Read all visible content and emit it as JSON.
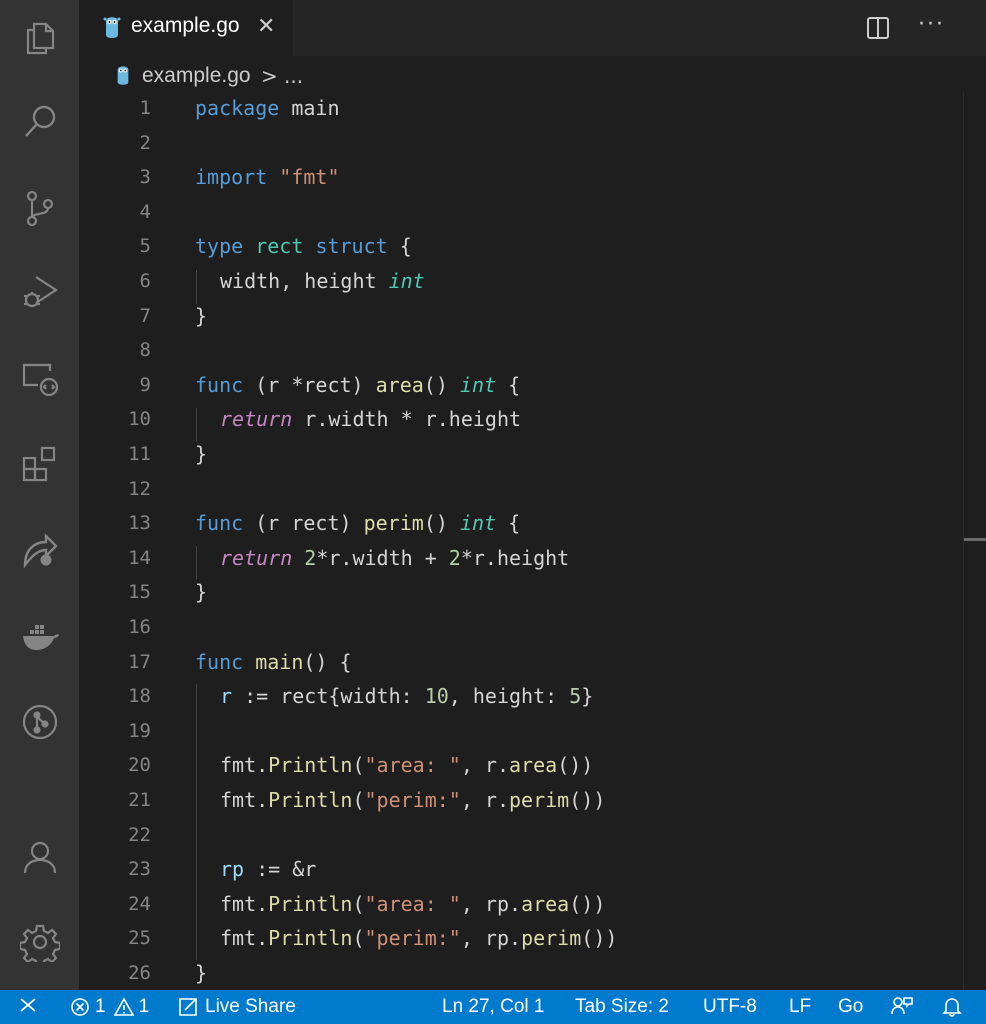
{
  "activity_bar": {
    "items": [
      {
        "name": "explorer-icon"
      },
      {
        "name": "search-icon"
      },
      {
        "name": "source-control-icon"
      },
      {
        "name": "run-debug-icon"
      },
      {
        "name": "remote-explorer-icon"
      },
      {
        "name": "extensions-icon"
      },
      {
        "name": "live-share-icon"
      },
      {
        "name": "docker-icon"
      },
      {
        "name": "gitlens-icon"
      }
    ],
    "bottom": [
      {
        "name": "account-icon"
      },
      {
        "name": "settings-gear-icon"
      }
    ]
  },
  "tab": {
    "label": "example.go",
    "close": "✕"
  },
  "tab_actions": {
    "more": "···"
  },
  "breadcrumb": {
    "file": "example.go",
    "separator": ">",
    "more": "..."
  },
  "code_lines": [
    {
      "n": "1"
    },
    {
      "n": "2"
    },
    {
      "n": "3"
    },
    {
      "n": "4"
    },
    {
      "n": "5"
    },
    {
      "n": "6"
    },
    {
      "n": "7"
    },
    {
      "n": "8"
    },
    {
      "n": "9"
    },
    {
      "n": "10"
    },
    {
      "n": "11"
    },
    {
      "n": "12"
    },
    {
      "n": "13"
    },
    {
      "n": "14"
    },
    {
      "n": "15"
    },
    {
      "n": "16"
    },
    {
      "n": "17"
    },
    {
      "n": "18"
    },
    {
      "n": "19"
    },
    {
      "n": "20"
    },
    {
      "n": "21"
    },
    {
      "n": "22"
    },
    {
      "n": "23"
    },
    {
      "n": "24"
    },
    {
      "n": "25"
    },
    {
      "n": "26"
    }
  ],
  "code": {
    "l1": {
      "a": "package",
      "b": " main"
    },
    "l3": {
      "a": "import",
      "b": " ",
      "c": "\"fmt\""
    },
    "l5": {
      "a": "type",
      "b": " ",
      "c": "rect",
      "d": " ",
      "e": "struct",
      "f": " {"
    },
    "l6": {
      "a": "width, height ",
      "b": "int"
    },
    "l7": {
      "a": "}"
    },
    "l9": {
      "a": "func",
      "b": " (r *rect) ",
      "c": "area",
      "d": "() ",
      "e": "int",
      "f": " {"
    },
    "l10": {
      "a": "return",
      "b": " r.width * r.height"
    },
    "l11": {
      "a": "}"
    },
    "l13": {
      "a": "func",
      "b": " (r rect) ",
      "c": "perim",
      "d": "() ",
      "e": "int",
      "f": " {"
    },
    "l14": {
      "a": "return",
      "b": " ",
      "c": "2",
      "d": "*r.width + ",
      "e": "2",
      "f": "*r.height"
    },
    "l15": {
      "a": "}"
    },
    "l17": {
      "a": "func",
      "b": " ",
      "c": "main",
      "d": "() {"
    },
    "l18": {
      "a": "r",
      "b": " := rect{width: ",
      "c": "10",
      "d": ", height: ",
      "e": "5",
      "f": "}"
    },
    "l20": {
      "a": "fmt.",
      "b": "Println",
      "c": "(",
      "d": "\"area: \"",
      "e": ", r.",
      "f": "area",
      "g": "())"
    },
    "l21": {
      "a": "fmt.",
      "b": "Println",
      "c": "(",
      "d": "\"perim:\"",
      "e": ", r.",
      "f": "perim",
      "g": "())"
    },
    "l23": {
      "a": "rp",
      "b": " := &r"
    },
    "l24": {
      "a": "fmt.",
      "b": "Println",
      "c": "(",
      "d": "\"area: \"",
      "e": ", rp.",
      "f": "area",
      "g": "())"
    },
    "l25": {
      "a": "fmt.",
      "b": "Println",
      "c": "(",
      "d": "\"perim:\"",
      "e": ", rp.",
      "f": "perim",
      "g": "())"
    },
    "l26": {
      "a": "}"
    }
  },
  "statusbar": {
    "errors": "1",
    "warnings": "1",
    "live_share": "Live Share",
    "cursor": "Ln 27, Col 1",
    "tab_size": "Tab Size: 2",
    "encoding": "UTF-8",
    "eol": "LF",
    "language": "Go"
  },
  "colors": {
    "statusbar": "#007acc",
    "activity_bar": "#333333",
    "editor_bg": "#1e1e1e",
    "keyword": "#569cd6",
    "type": "#4ec9b0",
    "string": "#ce9178",
    "function": "#dcdcaa",
    "number": "#b5cea8",
    "control": "#c586c0"
  }
}
